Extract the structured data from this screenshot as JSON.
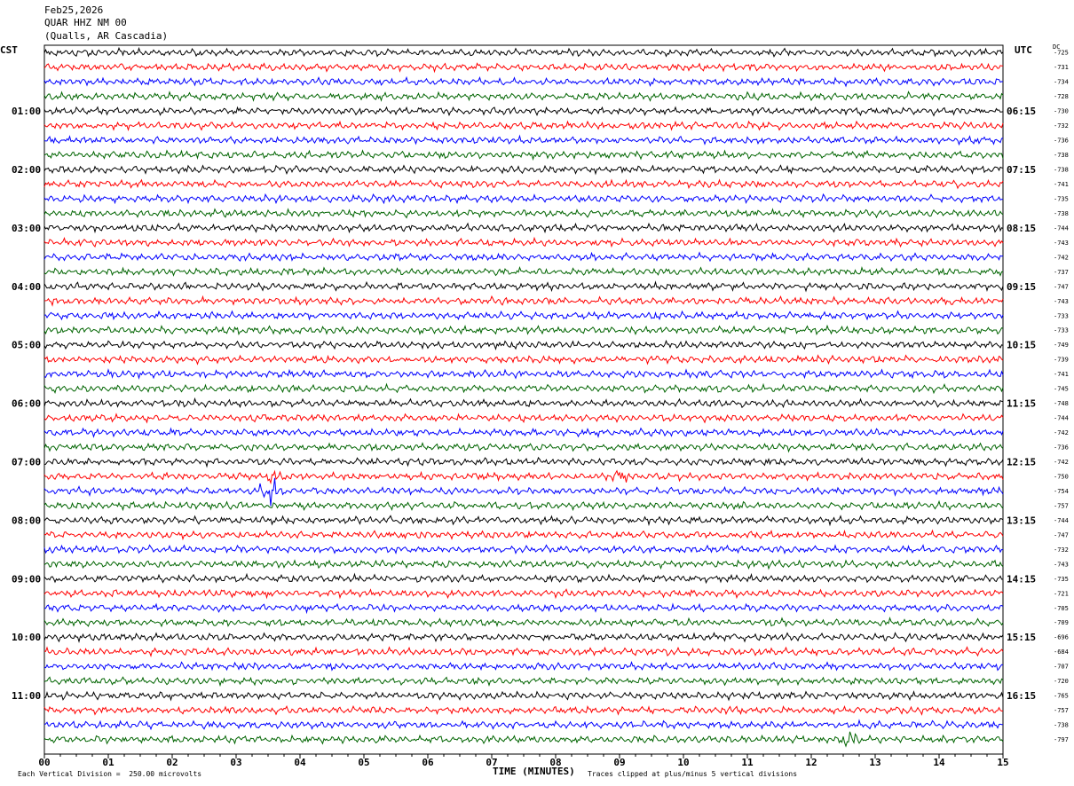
{
  "header": {
    "date": "Feb25,2026",
    "station": "QUAR HHZ NM 00",
    "location": "(Qualls, AR Cascadia)"
  },
  "left_zone": "CST",
  "right_zone": "UTC",
  "dc_label": "DC",
  "footer": {
    "scale_note": "Each Vertical Division =  250.00 microvolts",
    "clip_note": "Traces clipped at plus/minus 5 vertical divisions"
  },
  "chart_data": {
    "type": "line",
    "title": "QUAR HHZ NM 00",
    "xlabel": "TIME (MINUTES)",
    "xlim": [
      0,
      15
    ],
    "x_ticks": [
      "00",
      "01",
      "02",
      "03",
      "04",
      "05",
      "06",
      "07",
      "08",
      "09",
      "10",
      "11",
      "12",
      "13",
      "14",
      "15"
    ],
    "trace_count": 48,
    "trace_colors": [
      "#000000",
      "#ff0000",
      "#0000ff",
      "#006400"
    ],
    "left_time_labels": [
      "01:00",
      "02:00",
      "03:00",
      "04:00",
      "05:00",
      "06:00",
      "07:00",
      "08:00",
      "09:00",
      "10:00",
      "11:00"
    ],
    "right_time_labels": [
      "06:15",
      "07:15",
      "08:15",
      "09:15",
      "10:15",
      "11:15",
      "12:15",
      "13:15",
      "14:15",
      "15:15",
      "16:15"
    ],
    "hour_label_rows": [
      4,
      8,
      12,
      16,
      20,
      24,
      28,
      32,
      36,
      40,
      44
    ],
    "dc_offsets": [
      -725,
      -731,
      -734,
      -728,
      -730,
      -732,
      -736,
      -738,
      -738,
      -741,
      -735,
      -738,
      -744,
      -743,
      -742,
      -737,
      -747,
      -743,
      -733,
      -733,
      -749,
      -739,
      -741,
      -745,
      -748,
      -744,
      -742,
      -736,
      -742,
      -750,
      -754,
      -757,
      -744,
      -747,
      -732,
      -743,
      -735,
      -721,
      -705,
      -709,
      -696,
      -684,
      -707,
      -720,
      -765,
      -757,
      -738,
      -797
    ],
    "events": [
      {
        "row": 29,
        "minute": 3.6,
        "note": "burst"
      },
      {
        "row": 29,
        "minute": 9.0,
        "note": "burst"
      },
      {
        "row": 30,
        "minute": 3.55,
        "note": "large burst"
      },
      {
        "row": 47,
        "minute": 12.6,
        "note": "spike"
      }
    ]
  }
}
